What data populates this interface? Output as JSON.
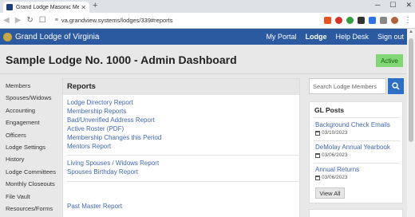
{
  "browser": {
    "tab_title": "Grand Lodge Masonic Membershi",
    "url": "va.grandview.systems/lodges/339#reports"
  },
  "header": {
    "brand": "Grand Lodge of Virginia",
    "nav": [
      "My Portal",
      "Lodge",
      "Help Desk",
      "Sign out"
    ],
    "active_nav": "Lodge"
  },
  "page": {
    "title": "Sample Lodge No. 1000 - Admin Dashboard",
    "status": "Active"
  },
  "sidebar": {
    "items": [
      "Members",
      "Spouses/Widows",
      "Accounting",
      "Engagement",
      "Officers",
      "Lodge Settings",
      "History",
      "Lodge Committees",
      "Monthly Closeouts",
      "File Vault",
      "Resources/Forms"
    ]
  },
  "reports": {
    "title": "Reports",
    "group1": [
      "Lodge Directory Report",
      "Membership Reports",
      "Bad/Unverified Address Report",
      "Active Roster (PDF)",
      "Membership Changes this Period",
      "Mentors Report"
    ],
    "group2": [
      "Living Spouses / Widows Report",
      "Spouses Birthday Report"
    ],
    "group3": [
      "Past Master Report"
    ]
  },
  "search": {
    "placeholder": "Search Lodge Members"
  },
  "gl_posts": {
    "title": "GL Posts",
    "posts": [
      {
        "title": "Background Check Emails",
        "date": "03/10/2023"
      },
      {
        "title": "DeMolay Annual Yearbook",
        "date": "03/06/2023"
      },
      {
        "title": "Annual Returns",
        "date": "03/06/2023"
      }
    ],
    "view_all": "View All"
  },
  "colors": {
    "header_bg": "#2c5aa0",
    "link": "#3f68b3",
    "active_badge": "#7fd874",
    "search_button": "#2d6fc4"
  }
}
